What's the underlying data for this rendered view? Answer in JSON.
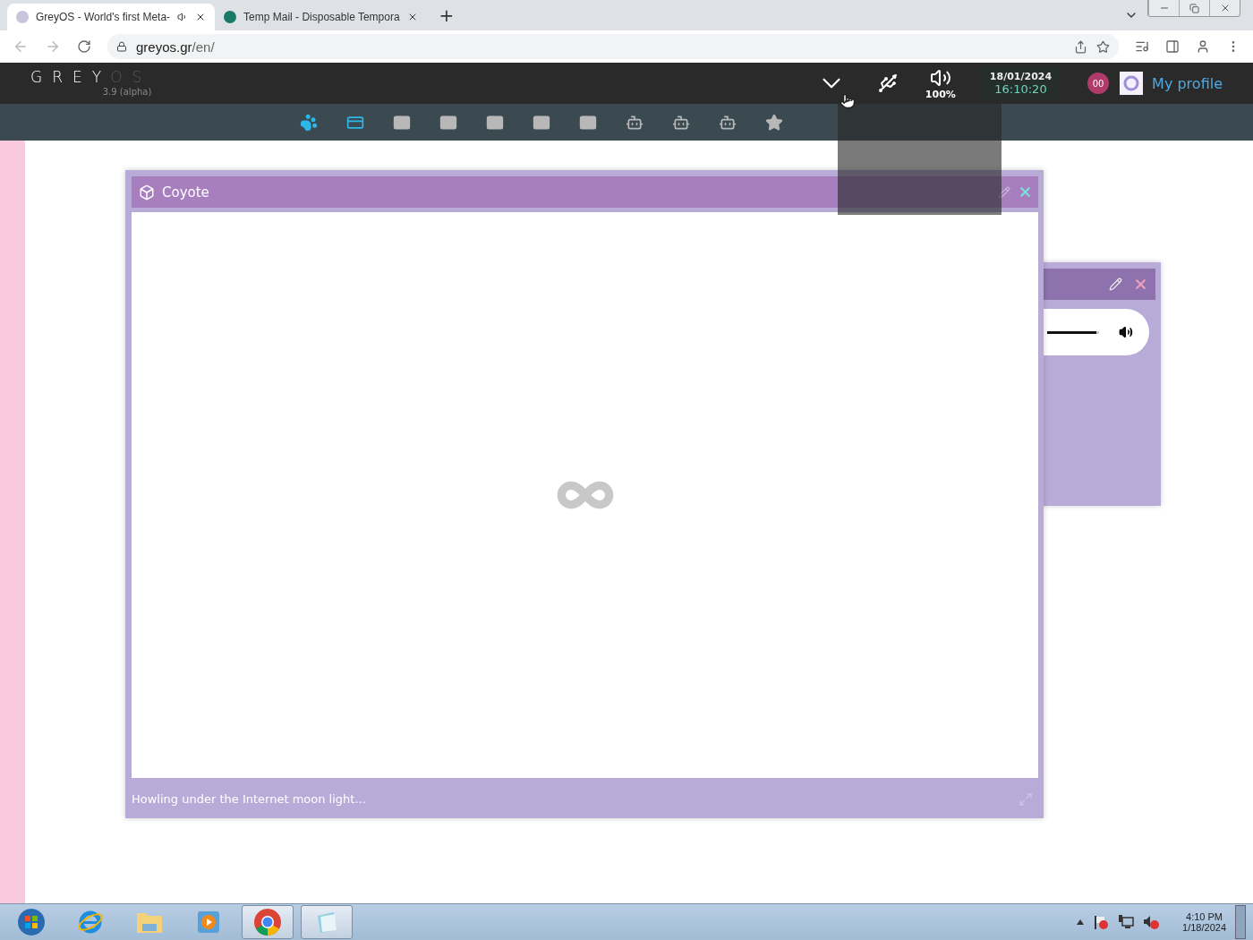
{
  "browser": {
    "tabs": [
      {
        "title": "GreyOS - World's first Meta-",
        "selected": true,
        "audio": true
      },
      {
        "title": "Temp Mail - Disposable Tempora",
        "selected": false,
        "audio": false
      }
    ],
    "new_tab": "+",
    "host": "greyos.gr",
    "path": "/en/"
  },
  "topbar": {
    "logo": "GREY",
    "logo_dim": "OS",
    "version": "3.9 (alpha)",
    "volume": "100%",
    "date": "18/01/2024",
    "time": "16:10:20",
    "notifications": "00",
    "profile": "My profile"
  },
  "dock": [
    {
      "kind": "paw",
      "active": true
    },
    {
      "kind": "card",
      "active": true
    },
    {
      "kind": "window",
      "active": false
    },
    {
      "kind": "window",
      "active": false
    },
    {
      "kind": "window",
      "active": false
    },
    {
      "kind": "window",
      "active": false
    },
    {
      "kind": "window",
      "active": false
    },
    {
      "kind": "robot",
      "active": false
    },
    {
      "kind": "robot",
      "active": false
    },
    {
      "kind": "robot",
      "active": false
    },
    {
      "kind": "star",
      "active": false
    }
  ],
  "coyote_window": {
    "title": "Coyote",
    "status": "Howling under the Internet moon light..."
  },
  "back_window": {
    "volume_slider": {
      "level": 0.95
    }
  },
  "taskbar": {
    "apps": [
      {
        "kind": "start",
        "open": false
      },
      {
        "kind": "browser",
        "open": false
      },
      {
        "kind": "folder",
        "open": false
      },
      {
        "kind": "media",
        "open": false
      },
      {
        "kind": "chrome",
        "open": true
      },
      {
        "kind": "notepad",
        "open": true
      }
    ],
    "time": "4:10 PM",
    "date": "1/18/2024"
  }
}
